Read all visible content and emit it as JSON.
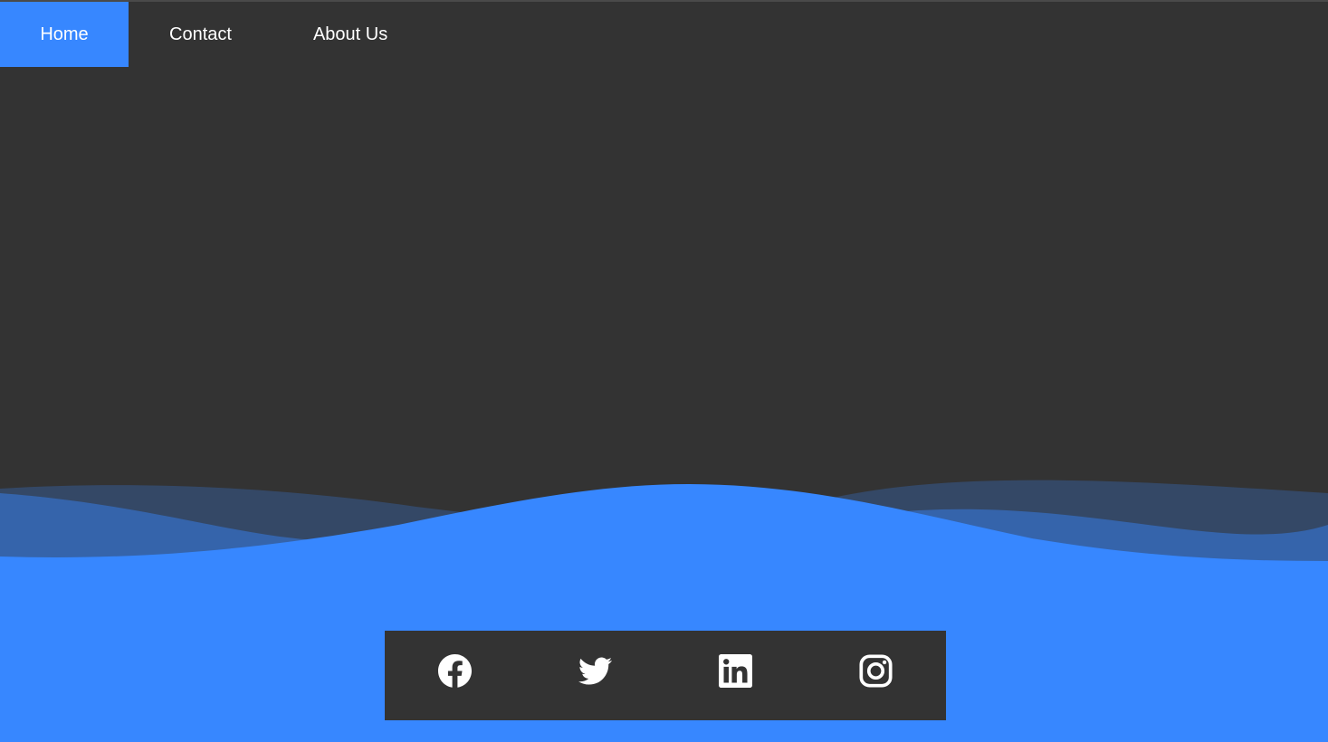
{
  "nav": {
    "items": [
      {
        "label": "Home",
        "active": true
      },
      {
        "label": "Contact",
        "active": false
      },
      {
        "label": "About Us",
        "active": false
      }
    ]
  },
  "colors": {
    "background": "#333333",
    "accent": "#3787ff",
    "text": "#ffffff"
  },
  "footer": {
    "social": [
      {
        "icon": "facebook-icon"
      },
      {
        "icon": "twitter-icon"
      },
      {
        "icon": "linkedin-icon"
      },
      {
        "icon": "instagram-icon"
      }
    ]
  }
}
